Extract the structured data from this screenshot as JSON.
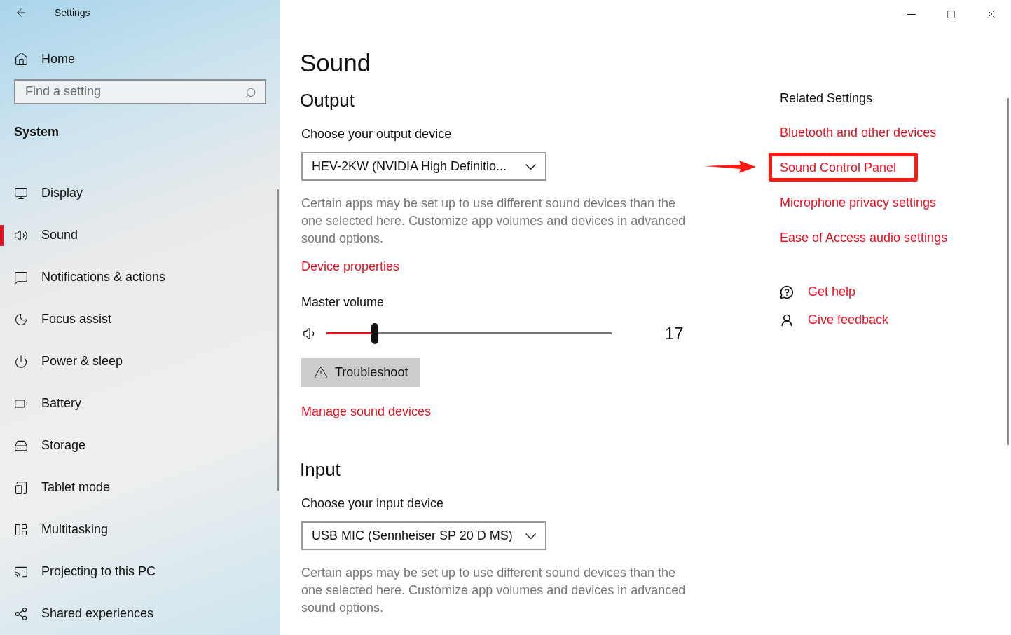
{
  "window": {
    "title": "Settings"
  },
  "sidebar": {
    "home": "Home",
    "search": {
      "placeholder": "Find a setting"
    },
    "section": "System",
    "items": [
      {
        "label": "Display",
        "selected": false
      },
      {
        "label": "Sound",
        "selected": true
      },
      {
        "label": "Notifications & actions",
        "selected": false
      },
      {
        "label": "Focus assist",
        "selected": false
      },
      {
        "label": "Power & sleep",
        "selected": false
      },
      {
        "label": "Battery",
        "selected": false
      },
      {
        "label": "Storage",
        "selected": false
      },
      {
        "label": "Tablet mode",
        "selected": false
      },
      {
        "label": "Multitasking",
        "selected": false
      },
      {
        "label": "Projecting to this PC",
        "selected": false
      },
      {
        "label": "Shared experiences",
        "selected": false
      }
    ]
  },
  "page": {
    "title": "Sound",
    "output": {
      "heading": "Output",
      "label": "Choose your output device",
      "device": "HEV-2KW (NVIDIA High Definitio...",
      "note": "Certain apps may be set up to use different sound devices than the one selected here. Customize app volumes and devices in advanced sound options.",
      "link": "Device properties",
      "volume": {
        "label": "Master volume",
        "level": 0.17,
        "reading": "17"
      },
      "button": "Troubleshoot",
      "link2": "Manage sound devices"
    },
    "input": {
      "heading": "Input",
      "label": "Choose your input device",
      "device": "USB MIC (Sennheiser SP 20 D MS)",
      "note": "Certain apps may be set up to use different sound devices than the one selected here. Customize app volumes and devices in advanced sound options."
    }
  },
  "related": {
    "title": "Related Settings",
    "links": [
      {
        "label": "Bluetooth and other devices",
        "annotated": false
      },
      {
        "label": "Sound Control Panel",
        "annotated": true
      },
      {
        "label": "Microphone privacy settings",
        "annotated": false
      },
      {
        "label": "Ease of Access audio settings",
        "annotated": false
      }
    ],
    "help": [
      {
        "kind": "help",
        "label": "Get help"
      },
      {
        "kind": "feedback",
        "label": "Give feedback"
      }
    ]
  }
}
